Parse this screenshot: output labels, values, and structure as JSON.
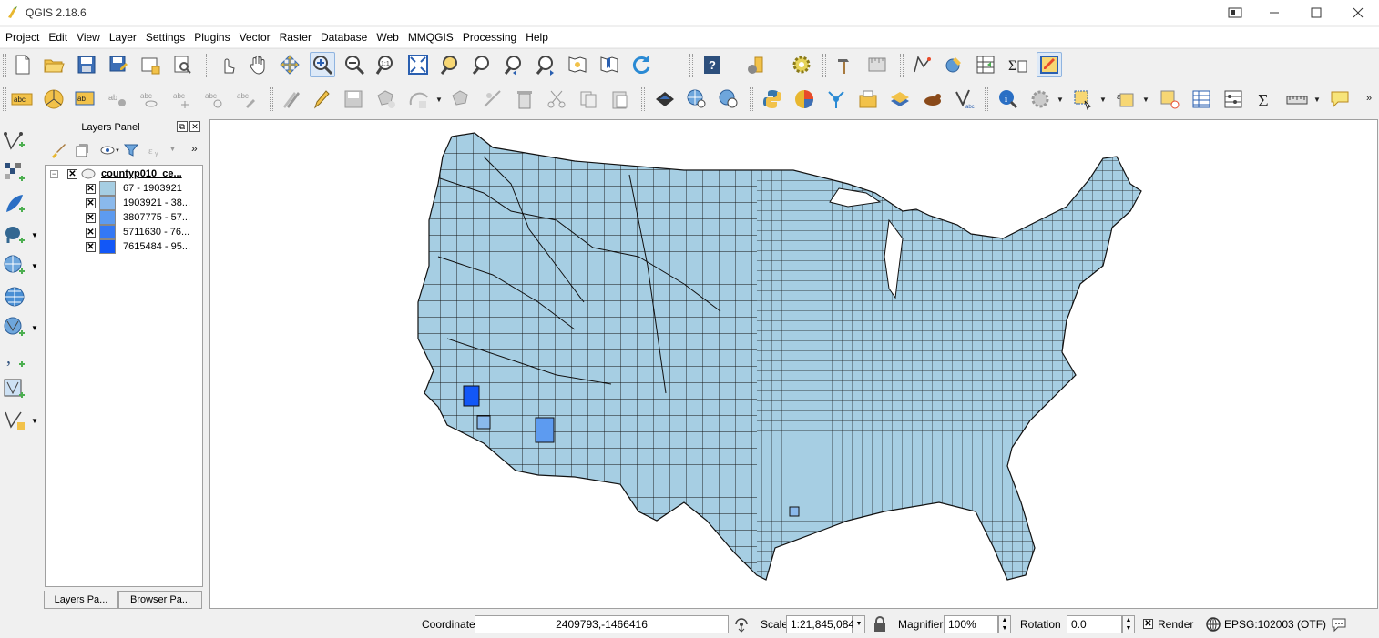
{
  "window": {
    "title": "QGIS 2.18.6",
    "controls": [
      "tablet-mode-icon",
      "minimize-icon",
      "maximize-icon",
      "close-icon"
    ]
  },
  "menu": [
    "Project",
    "Edit",
    "View",
    "Layer",
    "Settings",
    "Plugins",
    "Vector",
    "Raster",
    "Database",
    "Web",
    "MMQGIS",
    "Processing",
    "Help"
  ],
  "layers_panel": {
    "title": "Layers Panel",
    "layer": {
      "name": "countyp010_ce...",
      "checked": true,
      "classes": [
        {
          "label": "67 - 1903921",
          "color": "#a6cee3"
        },
        {
          "label": "1903921 - 38...",
          "color": "#8ab9ec"
        },
        {
          "label": "3807775 - 57...",
          "color": "#5d9bf0"
        },
        {
          "label": "5711630 - 76...",
          "color": "#3478f5"
        },
        {
          "label": "7615484 - 95...",
          "color": "#1257f7"
        }
      ]
    },
    "tabs": [
      "Layers Pa...",
      "Browser Pa..."
    ]
  },
  "map": {
    "fill_color": "#a6cee3",
    "highlight_colors": [
      "#1257f7",
      "#5d9bf0",
      "#8ab9ec"
    ]
  },
  "status": {
    "coordinate_label": "Coordinate",
    "coordinate_value": "2409793,-1466416",
    "scale_label": "Scale",
    "scale_value": "1:21,845,084",
    "magnifier_label": "Magnifier",
    "magnifier_value": "100%",
    "rotation_label": "Rotation",
    "rotation_value": "0.0",
    "render_label": "Render",
    "crs": "EPSG:102003 (OTF)"
  }
}
